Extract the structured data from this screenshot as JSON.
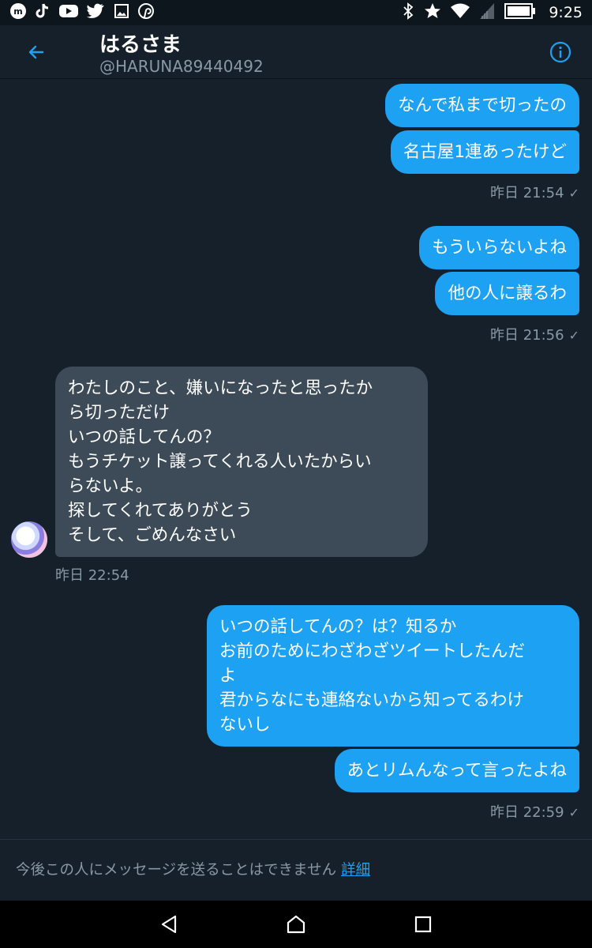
{
  "status_bar": {
    "left_icons": [
      "messenger-icon",
      "tiktok-icon",
      "youtube-icon",
      "twitter-icon",
      "gallery-icon",
      "pinterest-icon"
    ],
    "right_icons": [
      "bluetooth-icon",
      "star-icon",
      "wifi-icon",
      "signal-icon",
      "battery-icon"
    ],
    "time": "9:25"
  },
  "header": {
    "title": "はるさま",
    "handle": "@HARUNA89440492"
  },
  "messages": [
    {
      "dir": "out",
      "text": "なんで私まで切ったの"
    },
    {
      "dir": "out",
      "text": "名古屋1連あったけど"
    },
    {
      "dir": "out",
      "text": "もういらないよね"
    },
    {
      "dir": "out",
      "text": "他の人に譲るわ"
    },
    {
      "dir": "in",
      "text": "わたしのこと、嫌いになったと思ったか\nら切っただけ\nいつの話してんの？\nもうチケット譲ってくれる人いたからい\nらないよ。\n探してくれてありがとう\nそして、ごめんなさい"
    },
    {
      "dir": "out",
      "text": "いつの話してんの？は？知るか\nお前のためにわざわざツイートしたんだ\nよ\n君からなにも連絡ないから知ってるわけ\nないし"
    },
    {
      "dir": "out",
      "text": "あとリムんなって言ったよね"
    }
  ],
  "timestamps": [
    "昨日 21:54",
    "昨日 21:56",
    "昨日 22:54",
    "昨日 22:59"
  ],
  "footer": {
    "notice": "今後この人にメッセージを送ることはできません",
    "link": "詳細"
  },
  "colors": {
    "background": "#15202b",
    "outgoing_bubble": "#1da1f2",
    "incoming_bubble": "#3d4b58",
    "secondary_text": "#8899a6",
    "accent": "#1da1f2"
  }
}
